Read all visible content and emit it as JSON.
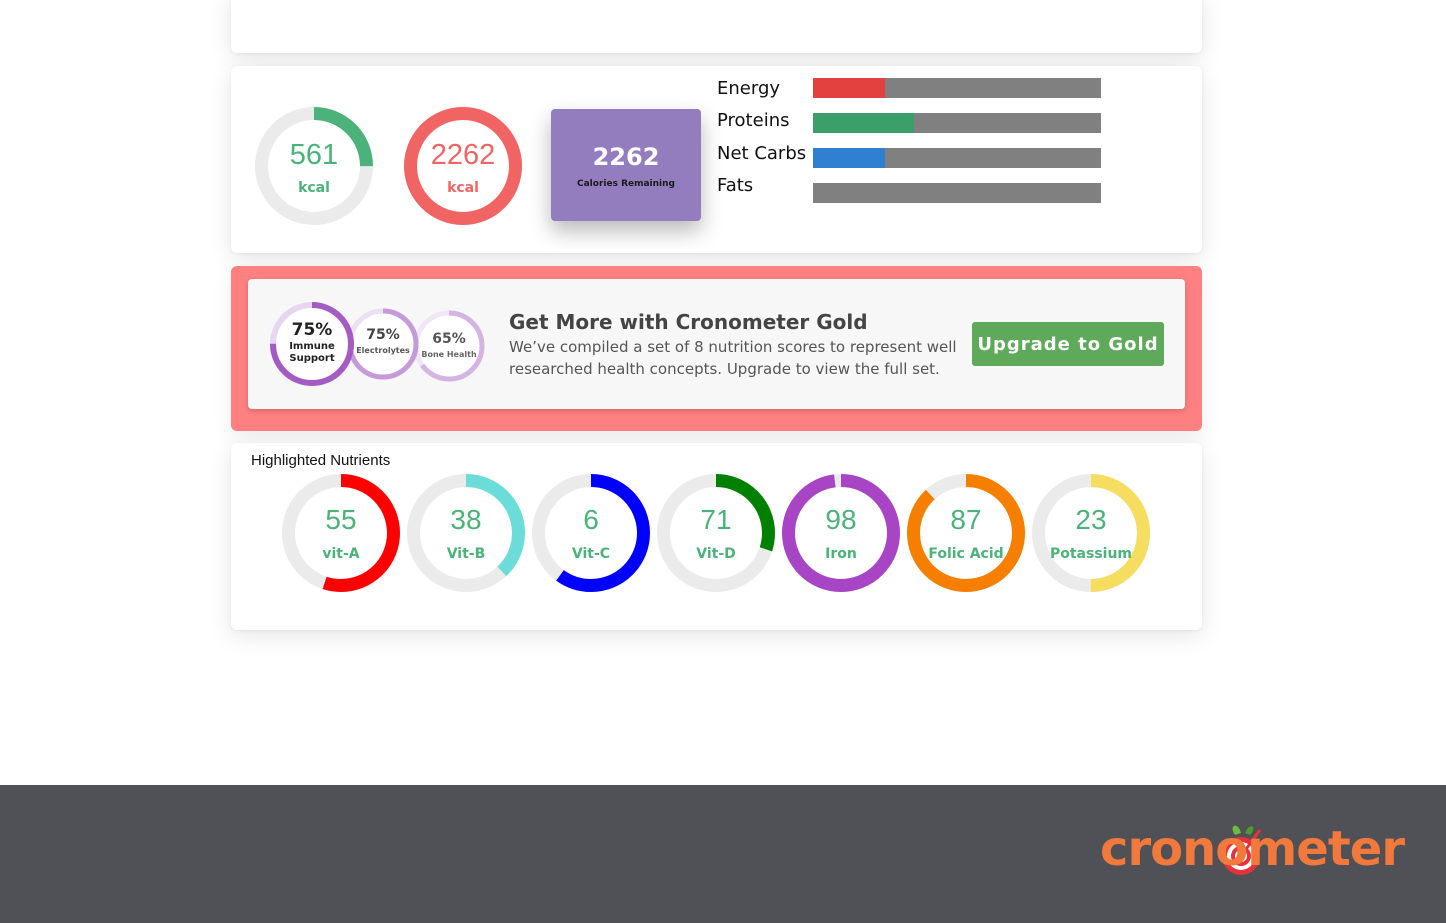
{
  "summary": {
    "consumed": {
      "value": "561",
      "unit": "kcal",
      "color": "#4bb37a",
      "fraction": 0.25
    },
    "budget": {
      "value": "2262",
      "unit": "kcal",
      "color": "#f06464",
      "fraction": 1.0
    },
    "remaining": {
      "value": "2262",
      "label": "Calories Remaining",
      "color": "#937dbe"
    }
  },
  "macros": [
    {
      "label": "Energy",
      "fraction": 0.25,
      "color": "#e34040"
    },
    {
      "label": "Proteins",
      "fraction": 0.35,
      "color": "#3c9e68"
    },
    {
      "label": "Net Carbs",
      "fraction": 0.25,
      "color": "#2f80d0"
    },
    {
      "label": "Fats",
      "fraction": 0.0,
      "color": "#808080"
    }
  ],
  "gold": {
    "title": "Get More with Cronometer Gold",
    "description": "We’ve compiled a set of 8 nutrition scores to represent well researched health concepts. Upgrade to view the full set.",
    "button_label": "Upgrade to Gold",
    "scores": [
      {
        "pct": "75%",
        "label1": "Immune",
        "label2": "Support",
        "fraction": 0.75
      },
      {
        "pct": "75%",
        "label1": "Electrolytes",
        "label2": "",
        "fraction": 0.75
      },
      {
        "pct": "65%",
        "label1": "Bone Health",
        "label2": "",
        "fraction": 0.65
      }
    ]
  },
  "nutrients": {
    "title": "Highlighted Nutrients",
    "items": [
      {
        "value": "55",
        "label": "vit-A",
        "fraction": 0.55,
        "color": "#ff0000"
      },
      {
        "value": "38",
        "label": "Vit-B",
        "fraction": 0.38,
        "color": "#6cdcd8"
      },
      {
        "value": "6",
        "label": "Vit-C",
        "fraction": 0.6,
        "color": "#0000ff"
      },
      {
        "value": "71",
        "label": "Vit-D",
        "fraction": 0.3,
        "color": "#008000"
      },
      {
        "value": "98",
        "label": "Iron",
        "fraction": 0.98,
        "color": "#a845c4"
      },
      {
        "value": "87",
        "label": "Folic Acid",
        "fraction": 0.88,
        "color": "#f77f00"
      },
      {
        "value": "23",
        "label": "Potassium",
        "fraction": 0.5,
        "color": "#f5dd60"
      }
    ]
  },
  "footer": {
    "logo_text": "cronometer",
    "logo_color": "#f2793c"
  }
}
